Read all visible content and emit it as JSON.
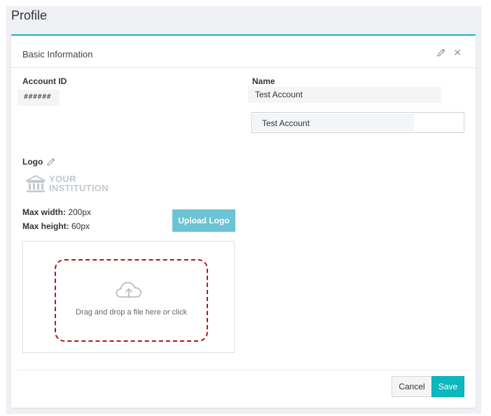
{
  "page": {
    "title": "Profile"
  },
  "card": {
    "title": "Basic Information",
    "edit_icon": "pencil-icon",
    "close_icon": "close-icon",
    "close_glyph": "✕",
    "accent_color": "#17b6c4"
  },
  "account": {
    "label": "Account ID",
    "value": "######"
  },
  "name": {
    "label": "Name",
    "display_value": "Test Account",
    "input_value": "Test Account"
  },
  "logo": {
    "label": "Logo",
    "edit_icon": "pencil-icon",
    "image_icon": "institution-building-icon",
    "image_text_line1": "YOUR",
    "image_text_line2": "INSTITUTION",
    "max_width_label": "Max width:",
    "max_width_value": " 200px",
    "max_height_label": "Max height:",
    "max_height_value": " 60px",
    "upload_button": "Upload Logo",
    "upload_button_color": "#6cc3d3"
  },
  "dropzone": {
    "icon": "cloud-upload-icon",
    "text": "Drag and drop a file here or click",
    "border_color": "#b3141c"
  },
  "footer": {
    "cancel_label": "Cancel",
    "save_label": "Save",
    "save_color": "#0cb8bf"
  }
}
